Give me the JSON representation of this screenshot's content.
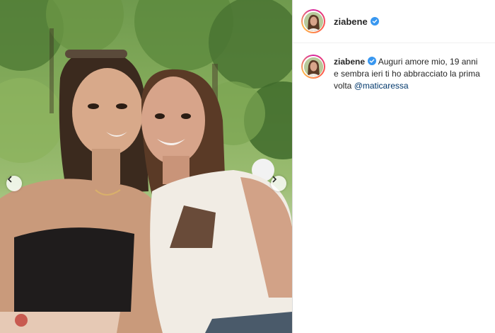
{
  "post": {
    "author": {
      "username": "ziabene",
      "verified": true,
      "verified_color": "#3897f0"
    },
    "caption": {
      "username": "ziabene",
      "text": "Auguri amore mio, 19 anni e sembra ieri ti ho abbracciato la prima volta ",
      "mention": "@maticaressa",
      "mention_color": "#00376b"
    },
    "media": {
      "prev_icon": "chevron-left-icon",
      "next_icon": "chevron-right-icon"
    }
  }
}
